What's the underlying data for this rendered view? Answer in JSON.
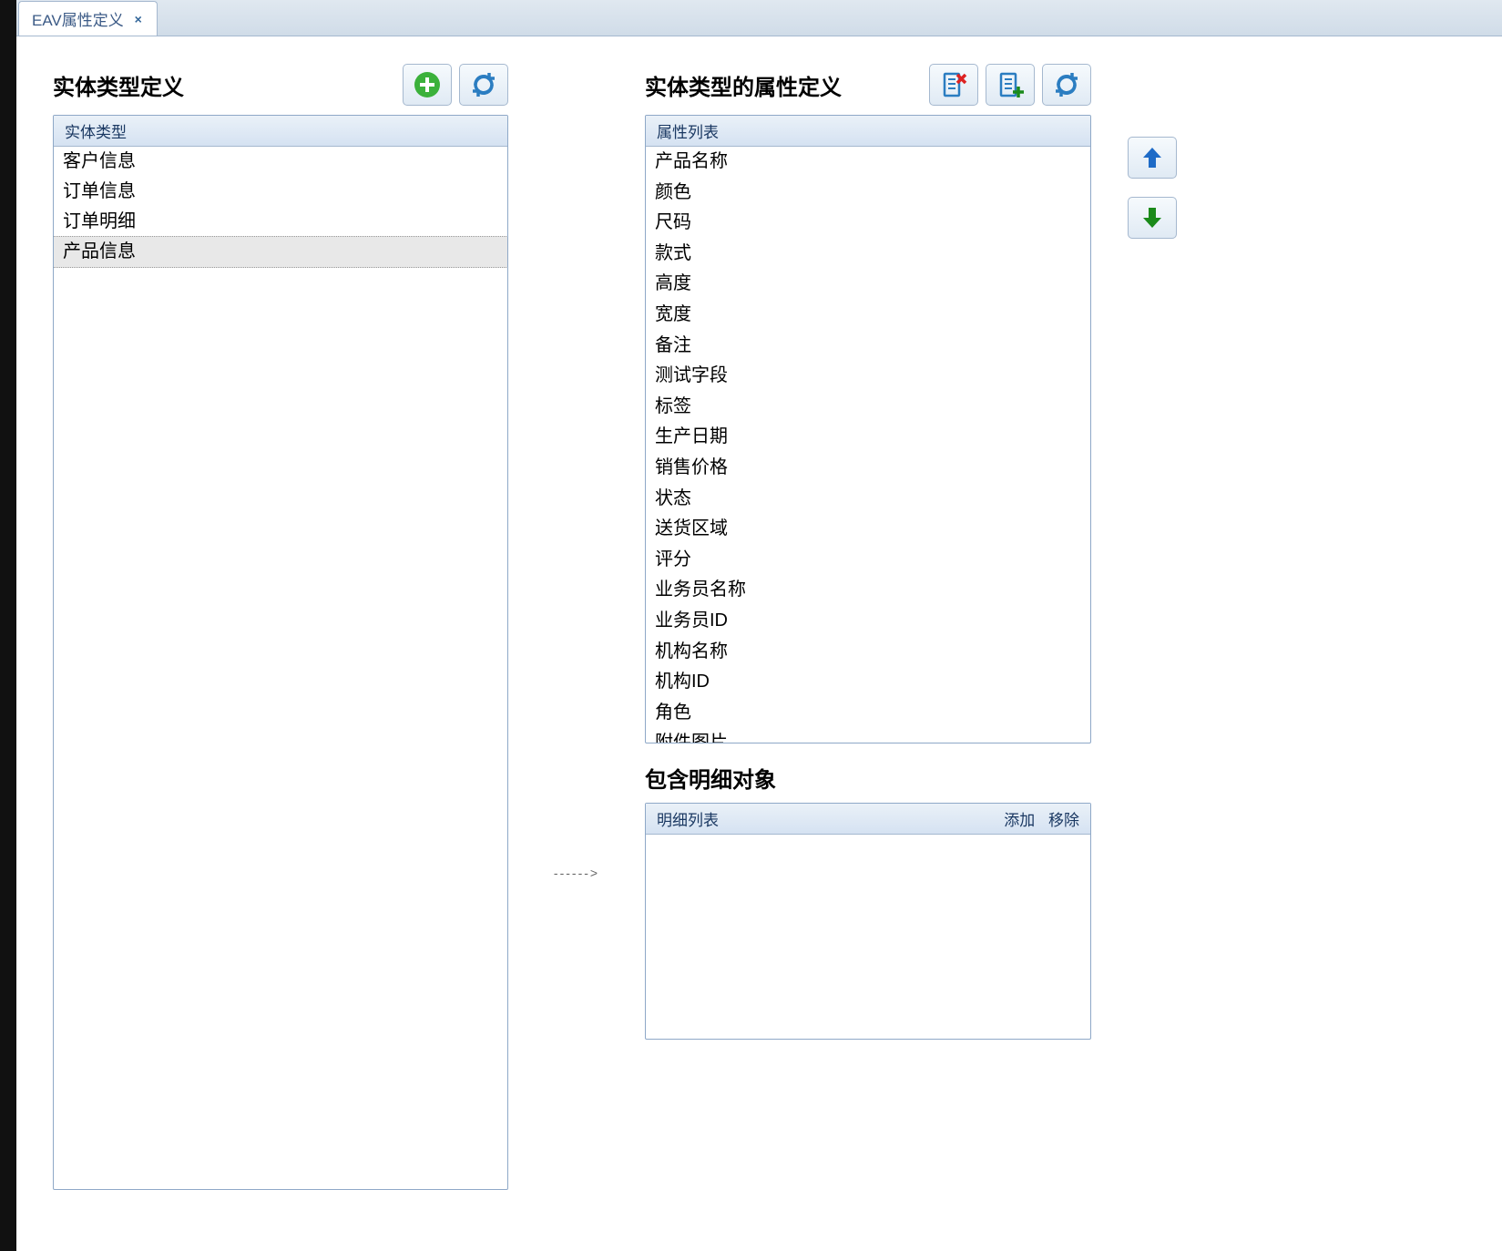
{
  "tab": {
    "label": "EAV属性定义"
  },
  "left": {
    "title": "实体类型定义",
    "header": "实体类型",
    "items": [
      "客户信息",
      "订单信息",
      "订单明细",
      "产品信息"
    ],
    "selected_index": 3,
    "buttons": {
      "add": "add",
      "refresh": "refresh"
    }
  },
  "arrow": "------>",
  "right": {
    "title": "实体类型的属性定义",
    "header": "属性列表",
    "items": [
      "产品名称",
      "颜色",
      "尺码",
      "款式",
      "高度",
      "宽度",
      "备注",
      "测试字段",
      "标签",
      "生产日期",
      "销售价格",
      "状态",
      "送货区域",
      "评分",
      "业务员名称",
      "业务员ID",
      "机构名称",
      "机构ID",
      "角色",
      "附件图片"
    ],
    "buttons": {
      "delete_doc": "doc-delete",
      "add_doc": "doc-add",
      "refresh": "refresh"
    }
  },
  "detail": {
    "title": "包含明细对象",
    "header": "明细列表",
    "add_label": "添加",
    "remove_label": "移除"
  },
  "updown": {
    "up": "up",
    "down": "down"
  }
}
